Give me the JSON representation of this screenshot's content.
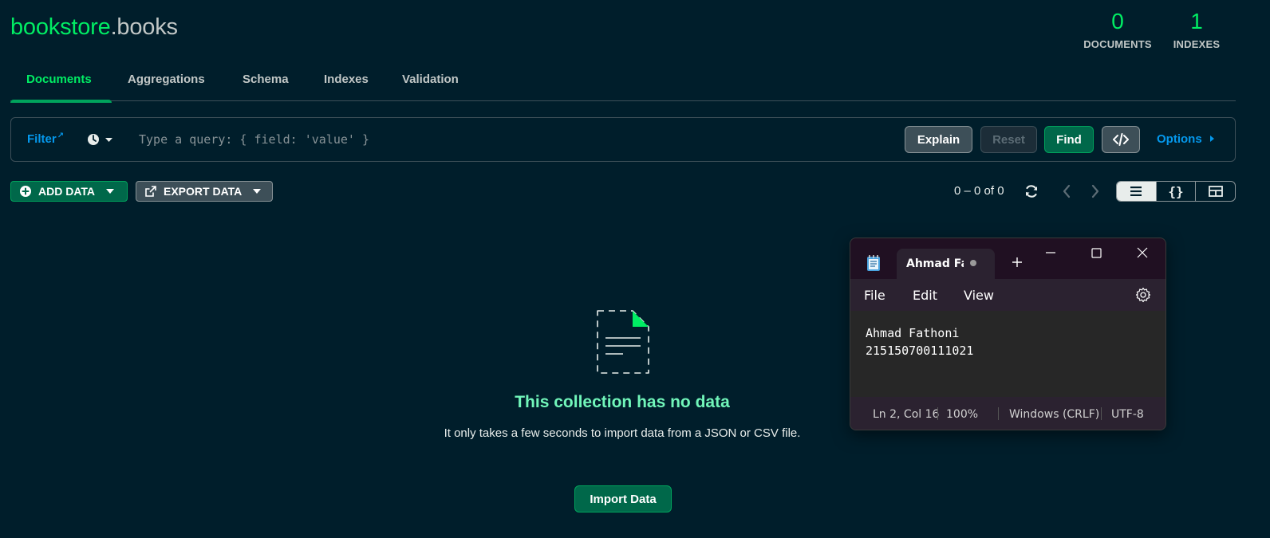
{
  "header": {
    "db_name": "bookstore",
    "collection_name": ".books",
    "stats": [
      {
        "value": "0",
        "label": "DOCUMENTS"
      },
      {
        "value": "1",
        "label": "INDEXES"
      }
    ]
  },
  "tabs": [
    {
      "label": "Documents",
      "active": true
    },
    {
      "label": "Aggregations"
    },
    {
      "label": "Schema"
    },
    {
      "label": "Indexes"
    },
    {
      "label": "Validation"
    }
  ],
  "query_bar": {
    "filter_label": "Filter",
    "placeholder": "Type a query: { field: 'value' }",
    "explain_label": "Explain",
    "reset_label": "Reset",
    "find_label": "Find",
    "options_label": "Options"
  },
  "toolbar": {
    "add_data_label": "ADD DATA",
    "export_data_label": "EXPORT DATA",
    "pagination_text": "0 – 0 of 0",
    "view_modes": [
      "list",
      "json",
      "table"
    ],
    "active_view": "list"
  },
  "empty_state": {
    "title": "This collection has no data",
    "description": "It only takes a few seconds to import data from a JSON or CSV file.",
    "import_label": "Import Data"
  },
  "notepad": {
    "tab_title": "Ahmad Fa",
    "menu": [
      "File",
      "Edit",
      "View"
    ],
    "lines": [
      "Ahmad Fathoni",
      "215150700111021"
    ],
    "status": {
      "position": "Ln 2, Col 16",
      "zoom": "100%",
      "line_ending": "Windows (CRLF)",
      "encoding": "UTF-8"
    }
  },
  "colors": {
    "background": "#001e2b",
    "accent_green": "#00ed64",
    "link_blue": "#0498ec",
    "button_green": "#00684a"
  }
}
